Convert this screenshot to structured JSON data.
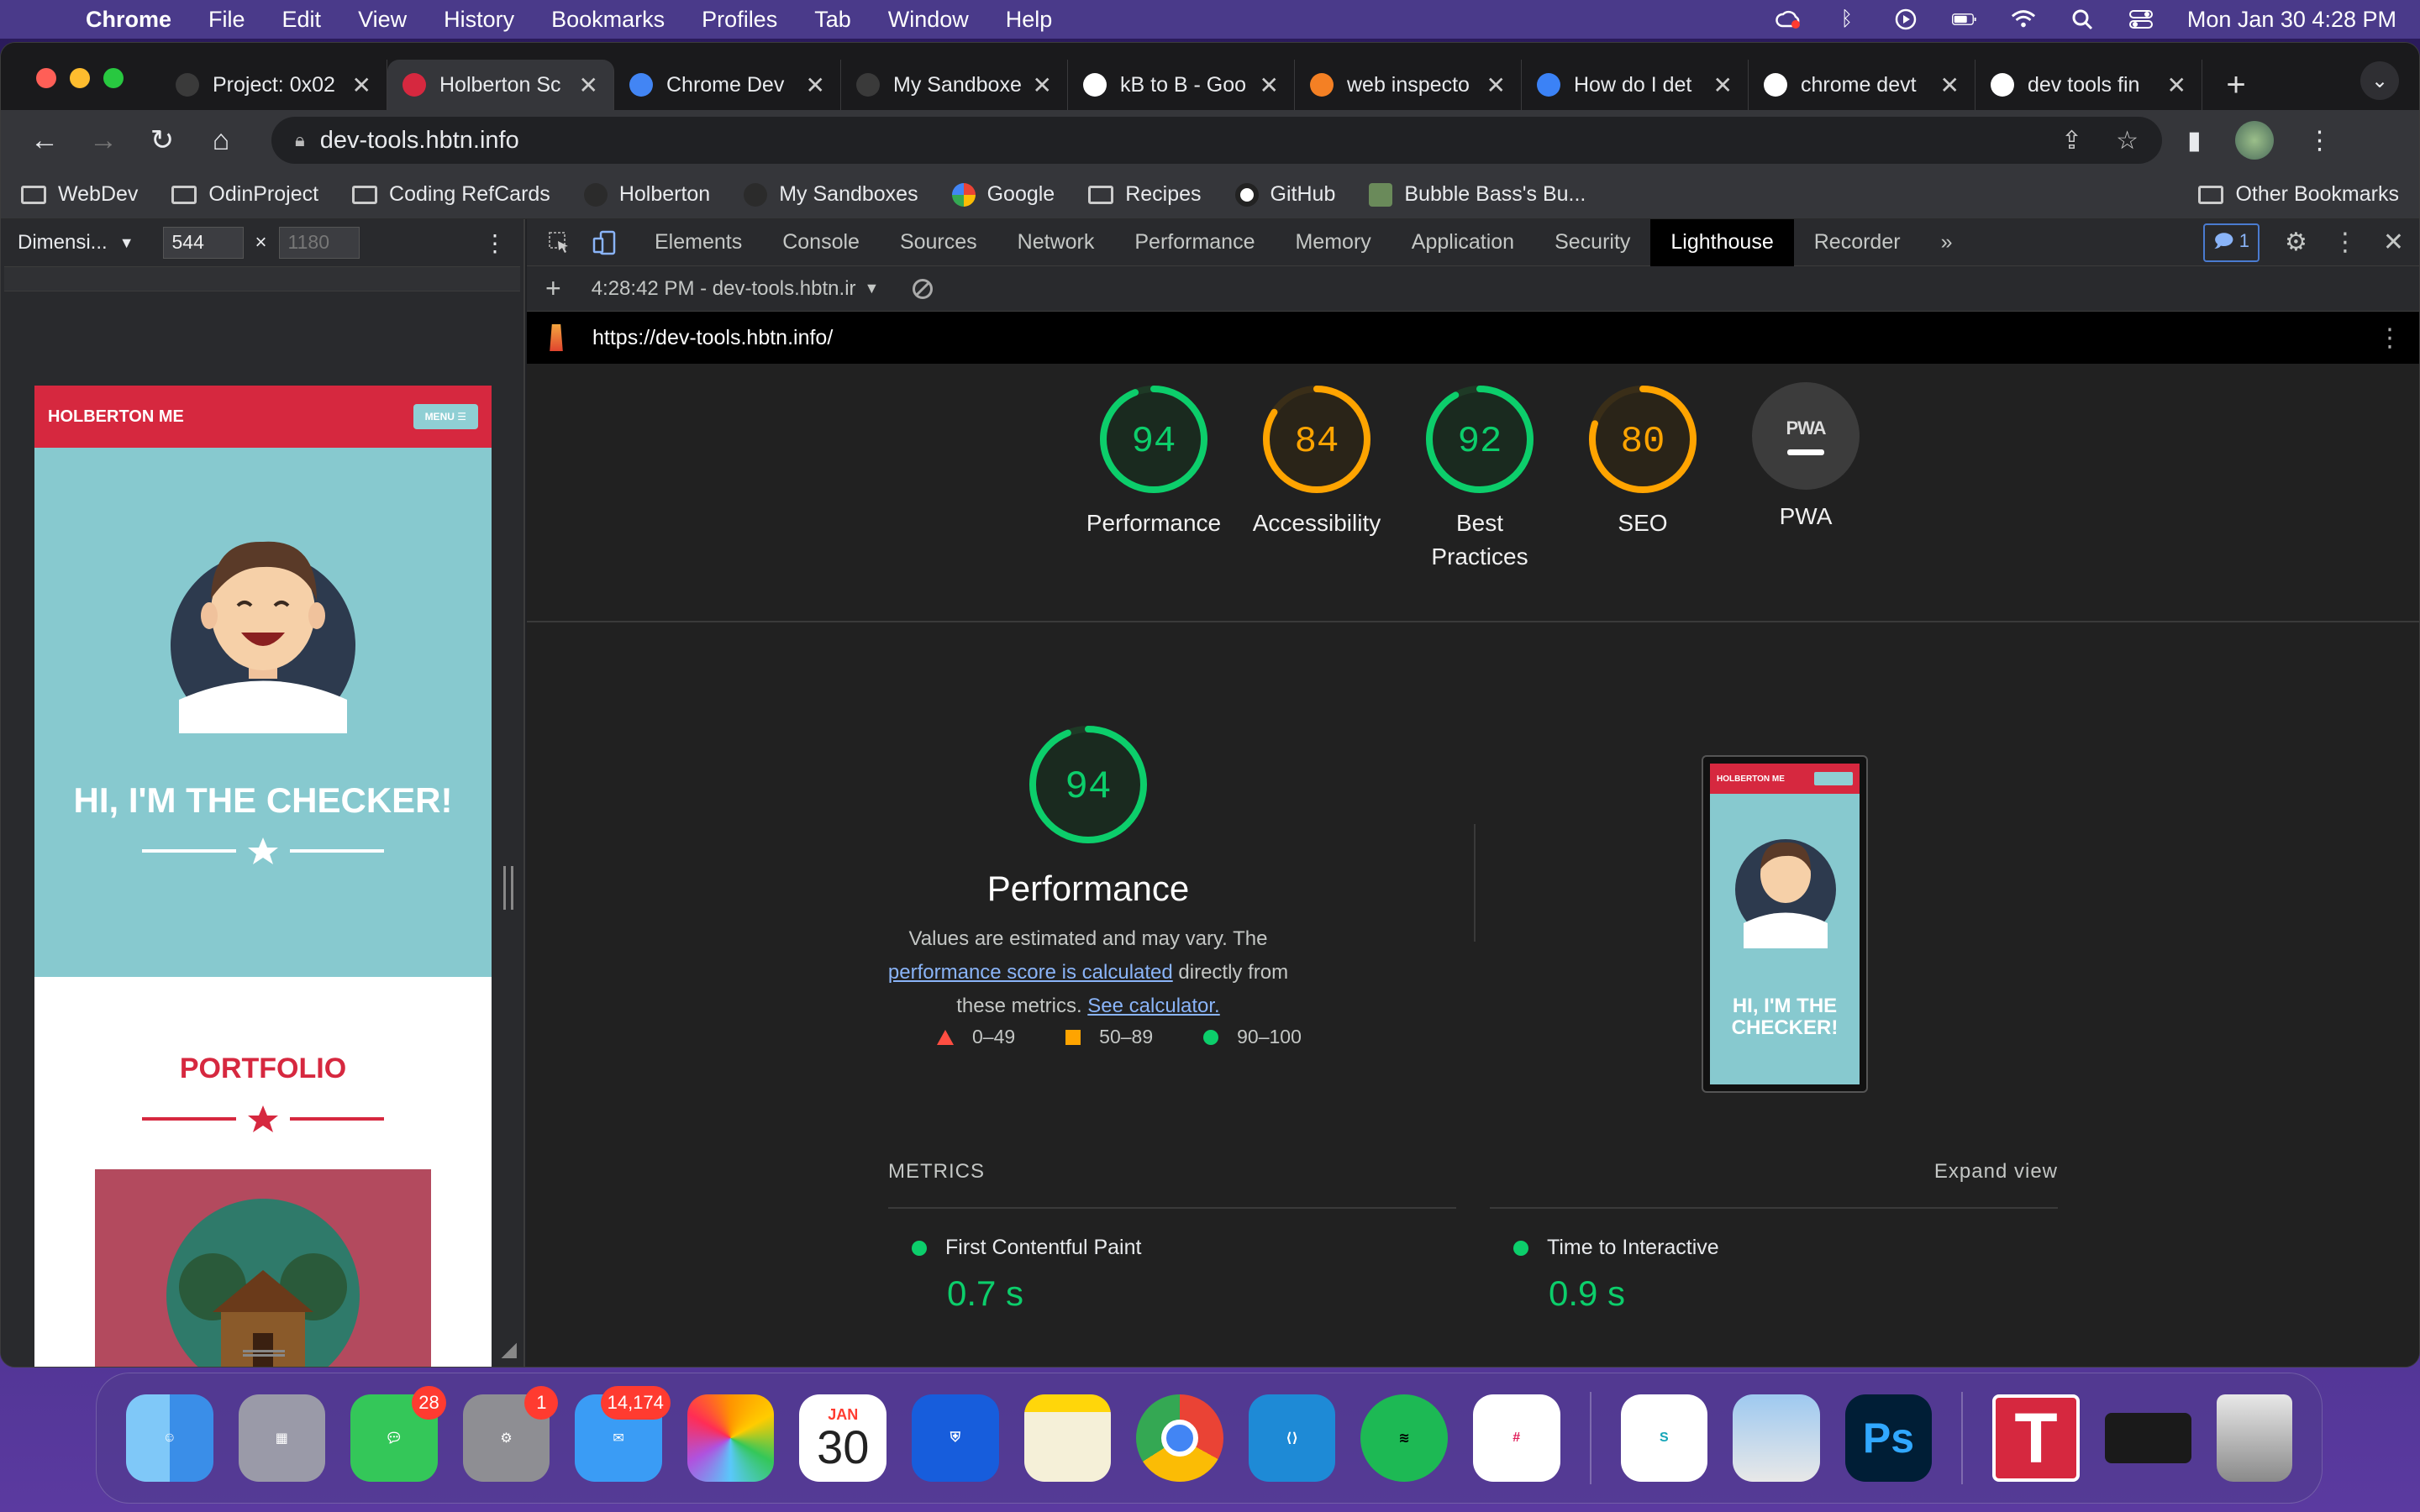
{
  "menubar": {
    "app": "Chrome",
    "items": [
      "File",
      "Edit",
      "View",
      "History",
      "Bookmarks",
      "Profiles",
      "Tab",
      "Window",
      "Help"
    ],
    "datetime": "Mon Jan 30  4:28 PM"
  },
  "tabs": [
    {
      "title": "Project: 0x02",
      "favicon_color": "#3a3a3a"
    },
    {
      "title": "Holberton Sc",
      "favicon_color": "#d6283f"
    },
    {
      "title": "Chrome Dev",
      "favicon_color": "#4285f4"
    },
    {
      "title": "My Sandboxe",
      "favicon_color": "#3a3a3a"
    },
    {
      "title": "kB to B - Goo",
      "favicon_color": "#ffffff"
    },
    {
      "title": "web inspecto",
      "favicon_color": "#f48024"
    },
    {
      "title": "How do I det",
      "favicon_color": "#3b82f6"
    },
    {
      "title": "chrome devt",
      "favicon_color": "#ffffff"
    },
    {
      "title": "dev tools fin",
      "favicon_color": "#ffffff"
    }
  ],
  "active_tab_index": 1,
  "omnibox": {
    "url": "dev-tools.hbtn.info"
  },
  "bookmarks": [
    {
      "label": "WebDev",
      "type": "folder"
    },
    {
      "label": "OdinProject",
      "type": "folder"
    },
    {
      "label": "Coding RefCards",
      "type": "folder"
    },
    {
      "label": "Holberton",
      "type": "site"
    },
    {
      "label": "My Sandboxes",
      "type": "site"
    },
    {
      "label": "Google",
      "type": "google"
    },
    {
      "label": "Recipes",
      "type": "folder"
    },
    {
      "label": "GitHub",
      "type": "github"
    },
    {
      "label": "Bubble Bass's Bu...",
      "type": "site"
    }
  ],
  "other_bookmarks": "Other Bookmarks",
  "device": {
    "preset": "Dimensi...",
    "width": "544",
    "times": "×",
    "height_placeholder": "1180"
  },
  "phone_page": {
    "brand": "HOLBERTON ME",
    "menu": "MENU ☰",
    "hero_title": "HI, I'M THE CHECKER!",
    "portfolio": "PORTFOLIO"
  },
  "devtools": {
    "tabs": [
      "Elements",
      "Console",
      "Sources",
      "Network",
      "Performance",
      "Memory",
      "Application",
      "Security",
      "Lighthouse",
      "Recorder"
    ],
    "active_tab": "Lighthouse",
    "issues_count": "1",
    "report_selector": "4:28:42 PM - dev-tools.hbtn.ir",
    "report_url": "https://dev-tools.hbtn.info/"
  },
  "scores": [
    {
      "label": "Performance",
      "value": 94,
      "color": "#0cce6b"
    },
    {
      "label": "Accessibility",
      "value": 84,
      "color": "#ffa400"
    },
    {
      "label": "Best Practices",
      "value": 92,
      "color": "#0cce6b"
    },
    {
      "label": "SEO",
      "value": 80,
      "color": "#ffa400"
    }
  ],
  "pwa": {
    "label": "PWA",
    "badge": "PWA"
  },
  "performance": {
    "score": 94,
    "title": "Performance",
    "desc_1": "Values are estimated and may vary. The ",
    "link_1": "performance score is calculated",
    "desc_2": " directly from these metrics. ",
    "link_2": "See calculator.",
    "legend": [
      "0–49",
      "50–89",
      "90–100"
    ],
    "screenshot_brand": "HOLBERTON ME",
    "screenshot_title": "HI, I'M THE CHECKER!"
  },
  "metrics": {
    "heading": "METRICS",
    "expand": "Expand view",
    "items": [
      {
        "name": "First Contentful Paint",
        "value": "0.7 s"
      },
      {
        "name": "Time to Interactive",
        "value": "0.9 s"
      }
    ]
  },
  "dock": {
    "badges": {
      "messages": "28",
      "settings": "1",
      "mail": "14,174"
    },
    "calendar_month": "JAN",
    "calendar_day": "30"
  }
}
